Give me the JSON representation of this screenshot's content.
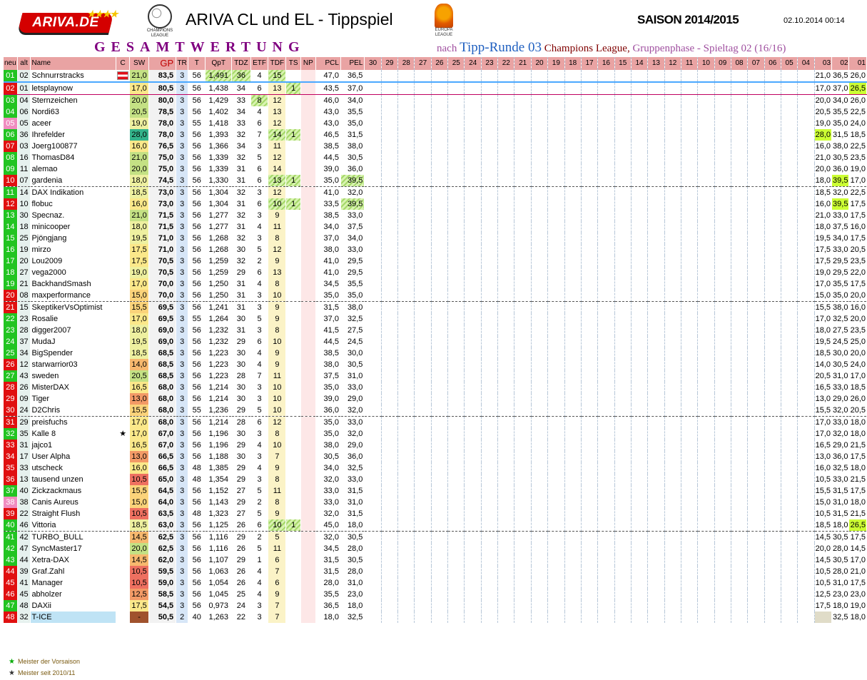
{
  "header": {
    "logo_text": "ARIVA.DE",
    "cl_logo_text": "CHAMPIONS LEAGUE",
    "el_logo_text": "EUROPA LEAGUE",
    "title": "ARIVA CL und EL - Tippspiel",
    "season": "SAISON 2014/2015",
    "timestamp": "02.10.2014 00:14",
    "gesamt": "GESAMTWERTUNG",
    "nach_1": "nach",
    "nach_2": "Tipp-Runde 03",
    "nach_3": "Champions League,",
    "nach_4": "Gruppenphase - Spieltag 02 (16/16)"
  },
  "columns": [
    "neu",
    "alt",
    "Name",
    "C",
    "SW",
    "GP",
    "TR",
    "T",
    "QpT",
    "TDZ",
    "ETF",
    "TDF",
    "TS",
    "NP",
    "PCL",
    "PEL"
  ],
  "round_columns": [
    "30",
    "29",
    "28",
    "27",
    "26",
    "25",
    "24",
    "23",
    "22",
    "21",
    "20",
    "19",
    "18",
    "17",
    "16",
    "15",
    "14",
    "13",
    "12",
    "11",
    "10",
    "09",
    "08",
    "07",
    "06",
    "05",
    "04",
    "03",
    "02",
    "01"
  ],
  "rank_colors": {
    "green": "#22c422",
    "red": "#e01010",
    "pink": "#f08cc0"
  },
  "rows": [
    [
      "01",
      "02",
      "Schnurrstracks",
      "",
      "21,0",
      "83,5",
      "3",
      "56",
      "1,491",
      "36",
      "4",
      "15",
      "",
      "",
      "47,0",
      "36,5",
      "21,0",
      "36,5",
      "26,0"
    ],
    [
      "02",
      "01",
      "letsplaynow",
      "",
      "17,0",
      "80,5",
      "3",
      "56",
      "1,438",
      "34",
      "6",
      "13",
      "1",
      "",
      "43,5",
      "37,0",
      "17,0",
      "37,0",
      "26,5"
    ],
    [
      "03",
      "04",
      "Sternzeichen",
      "",
      "20,0",
      "80,0",
      "3",
      "56",
      "1,429",
      "33",
      "8",
      "12",
      "",
      "",
      "46,0",
      "34,0",
      "20,0",
      "34,0",
      "26,0"
    ],
    [
      "04",
      "06",
      "Nordi63",
      "",
      "20,5",
      "78,5",
      "3",
      "56",
      "1,402",
      "34",
      "4",
      "13",
      "",
      "",
      "43,0",
      "35,5",
      "20,5",
      "35,5",
      "22,5"
    ],
    [
      "05",
      "05",
      "aceer",
      "",
      "19,0",
      "78,0",
      "3",
      "55",
      "1,418",
      "33",
      "6",
      "12",
      "",
      "",
      "43,0",
      "35,0",
      "19,0",
      "35,0",
      "24,0"
    ],
    [
      "06",
      "36",
      "Ihrefelder",
      "",
      "28,0",
      "78,0",
      "3",
      "56",
      "1,393",
      "32",
      "7",
      "14",
      "1",
      "",
      "46,5",
      "31,5",
      "28,0",
      "31,5",
      "18,5"
    ],
    [
      "07",
      "03",
      "Joerg100877",
      "",
      "16,0",
      "76,5",
      "3",
      "56",
      "1,366",
      "34",
      "3",
      "11",
      "",
      "",
      "38,5",
      "38,0",
      "16,0",
      "38,0",
      "22,5"
    ],
    [
      "08",
      "16",
      "ThomasD84",
      "",
      "21,0",
      "75,0",
      "3",
      "56",
      "1,339",
      "32",
      "5",
      "12",
      "",
      "",
      "44,5",
      "30,5",
      "21,0",
      "30,5",
      "23,5"
    ],
    [
      "09",
      "11",
      "alemao",
      "",
      "20,0",
      "75,0",
      "3",
      "56",
      "1,339",
      "31",
      "6",
      "14",
      "",
      "",
      "39,0",
      "36,0",
      "20,0",
      "36,0",
      "19,0"
    ],
    [
      "10",
      "07",
      "gardenia",
      "",
      "18,0",
      "74,5",
      "3",
      "56",
      "1,330",
      "31",
      "6",
      "13",
      "1",
      "",
      "35,0",
      "39,5",
      "18,0",
      "39,5",
      "17,0"
    ],
    [
      "11",
      "14",
      "DAX Indikation",
      "",
      "18,5",
      "73,0",
      "3",
      "56",
      "1,304",
      "32",
      "3",
      "12",
      "",
      "",
      "41,0",
      "32,0",
      "18,5",
      "32,0",
      "22,5"
    ],
    [
      "12",
      "10",
      "flobuc",
      "",
      "16,0",
      "73,0",
      "3",
      "56",
      "1,304",
      "31",
      "6",
      "10",
      "1",
      "",
      "33,5",
      "39,5",
      "16,0",
      "39,5",
      "17,5"
    ],
    [
      "13",
      "30",
      "Specnaz.",
      "",
      "21,0",
      "71,5",
      "3",
      "56",
      "1,277",
      "32",
      "3",
      "9",
      "",
      "",
      "38,5",
      "33,0",
      "21,0",
      "33,0",
      "17,5"
    ],
    [
      "14",
      "18",
      "minicooper",
      "",
      "18,0",
      "71,5",
      "3",
      "56",
      "1,277",
      "31",
      "4",
      "11",
      "",
      "",
      "34,0",
      "37,5",
      "18,0",
      "37,5",
      "16,0"
    ],
    [
      "15",
      "25",
      "Pjöngjang",
      "",
      "19,5",
      "71,0",
      "3",
      "56",
      "1,268",
      "32",
      "3",
      "8",
      "",
      "",
      "37,0",
      "34,0",
      "19,5",
      "34,0",
      "17,5"
    ],
    [
      "16",
      "19",
      "mirzo",
      "",
      "17,5",
      "71,0",
      "3",
      "56",
      "1,268",
      "30",
      "5",
      "12",
      "",
      "",
      "38,0",
      "33,0",
      "17,5",
      "33,0",
      "20,5"
    ],
    [
      "17",
      "20",
      "Lou2009",
      "",
      "17,5",
      "70,5",
      "3",
      "56",
      "1,259",
      "32",
      "2",
      "9",
      "",
      "",
      "41,0",
      "29,5",
      "17,5",
      "29,5",
      "23,5"
    ],
    [
      "18",
      "27",
      "vega2000",
      "",
      "19,0",
      "70,5",
      "3",
      "56",
      "1,259",
      "29",
      "6",
      "13",
      "",
      "",
      "41,0",
      "29,5",
      "19,0",
      "29,5",
      "22,0"
    ],
    [
      "19",
      "21",
      "BackhandSmash",
      "",
      "17,0",
      "70,0",
      "3",
      "56",
      "1,250",
      "31",
      "4",
      "8",
      "",
      "",
      "34,5",
      "35,5",
      "17,0",
      "35,5",
      "17,5"
    ],
    [
      "20",
      "08",
      "maxperformance",
      "",
      "15,0",
      "70,0",
      "3",
      "56",
      "1,250",
      "31",
      "3",
      "10",
      "",
      "",
      "35,0",
      "35,0",
      "15,0",
      "35,0",
      "20,0"
    ],
    [
      "21",
      "15",
      "SkeptikerVsOptimist",
      "",
      "15,5",
      "69,5",
      "3",
      "56",
      "1,241",
      "31",
      "3",
      "9",
      "",
      "",
      "31,5",
      "38,0",
      "15,5",
      "38,0",
      "16,0"
    ],
    [
      "22",
      "23",
      "Rosalie",
      "",
      "17,0",
      "69,5",
      "3",
      "55",
      "1,264",
      "30",
      "5",
      "9",
      "",
      "",
      "37,0",
      "32,5",
      "17,0",
      "32,5",
      "20,0"
    ],
    [
      "23",
      "28",
      "digger2007",
      "",
      "18,0",
      "69,0",
      "3",
      "56",
      "1,232",
      "31",
      "3",
      "8",
      "",
      "",
      "41,5",
      "27,5",
      "18,0",
      "27,5",
      "23,5"
    ],
    [
      "24",
      "37",
      "MudaJ",
      "",
      "19,5",
      "69,0",
      "3",
      "56",
      "1,232",
      "29",
      "6",
      "10",
      "",
      "",
      "44,5",
      "24,5",
      "19,5",
      "24,5",
      "25,0"
    ],
    [
      "25",
      "34",
      "BigSpender",
      "",
      "18,5",
      "68,5",
      "3",
      "56",
      "1,223",
      "30",
      "4",
      "9",
      "",
      "",
      "38,5",
      "30,0",
      "18,5",
      "30,0",
      "20,0"
    ],
    [
      "26",
      "12",
      "starwarrior03",
      "",
      "14,0",
      "68,5",
      "3",
      "56",
      "1,223",
      "30",
      "4",
      "9",
      "",
      "",
      "38,0",
      "30,5",
      "14,0",
      "30,5",
      "24,0"
    ],
    [
      "27",
      "43",
      "sweden",
      "",
      "20,5",
      "68,5",
      "3",
      "56",
      "1,223",
      "28",
      "7",
      "11",
      "",
      "",
      "37,5",
      "31,0",
      "20,5",
      "31,0",
      "17,0"
    ],
    [
      "28",
      "26",
      "MisterDAX",
      "",
      "16,5",
      "68,0",
      "3",
      "56",
      "1,214",
      "30",
      "3",
      "10",
      "",
      "",
      "35,0",
      "33,0",
      "16,5",
      "33,0",
      "18,5"
    ],
    [
      "29",
      "09",
      "Tiger",
      "",
      "13,0",
      "68,0",
      "3",
      "56",
      "1,214",
      "30",
      "3",
      "10",
      "",
      "",
      "39,0",
      "29,0",
      "13,0",
      "29,0",
      "26,0"
    ],
    [
      "30",
      "24",
      "D2Chris",
      "",
      "15,5",
      "68,0",
      "3",
      "55",
      "1,236",
      "29",
      "5",
      "10",
      "",
      "",
      "36,0",
      "32,0",
      "15,5",
      "32,0",
      "20,5"
    ],
    [
      "31",
      "29",
      "preisfuchs",
      "",
      "17,0",
      "68,0",
      "3",
      "56",
      "1,214",
      "28",
      "6",
      "12",
      "",
      "",
      "35,0",
      "33,0",
      "17,0",
      "33,0",
      "18,0"
    ],
    [
      "32",
      "35",
      "Kalle 8",
      "★",
      "17,0",
      "67,0",
      "3",
      "56",
      "1,196",
      "30",
      "3",
      "8",
      "",
      "",
      "35,0",
      "32,0",
      "17,0",
      "32,0",
      "18,0"
    ],
    [
      "33",
      "31",
      "jajco1",
      "",
      "16,5",
      "67,0",
      "3",
      "56",
      "1,196",
      "29",
      "4",
      "10",
      "",
      "",
      "38,0",
      "29,0",
      "16,5",
      "29,0",
      "21,5"
    ],
    [
      "34",
      "17",
      "User Alpha",
      "",
      "13,0",
      "66,5",
      "3",
      "56",
      "1,188",
      "30",
      "3",
      "7",
      "",
      "",
      "30,5",
      "36,0",
      "13,0",
      "36,0",
      "17,5"
    ],
    [
      "35",
      "33",
      "utscheck",
      "",
      "16,0",
      "66,5",
      "3",
      "48",
      "1,385",
      "29",
      "4",
      "9",
      "",
      "",
      "34,0",
      "32,5",
      "16,0",
      "32,5",
      "18,0"
    ],
    [
      "36",
      "13",
      "tausend unzen",
      "",
      "10,5",
      "65,0",
      "3",
      "48",
      "1,354",
      "29",
      "3",
      "8",
      "",
      "",
      "32,0",
      "33,0",
      "10,5",
      "33,0",
      "21,5"
    ],
    [
      "37",
      "40",
      "Zickzackmaus",
      "",
      "15,5",
      "64,5",
      "3",
      "56",
      "1,152",
      "27",
      "5",
      "11",
      "",
      "",
      "33,0",
      "31,5",
      "15,5",
      "31,5",
      "17,5"
    ],
    [
      "38",
      "38",
      "Canis Aureus",
      "",
      "15,0",
      "64,0",
      "3",
      "56",
      "1,143",
      "29",
      "2",
      "8",
      "",
      "",
      "33,0",
      "31,0",
      "15,0",
      "31,0",
      "18,0"
    ],
    [
      "39",
      "22",
      "Straight Flush",
      "",
      "10,5",
      "63,5",
      "3",
      "48",
      "1,323",
      "27",
      "5",
      "9",
      "",
      "",
      "32,0",
      "31,5",
      "10,5",
      "31,5",
      "21,5"
    ],
    [
      "40",
      "46",
      "Vittoria",
      "",
      "18,5",
      "63,0",
      "3",
      "56",
      "1,125",
      "26",
      "6",
      "10",
      "1",
      "",
      "45,0",
      "18,0",
      "18,5",
      "18,0",
      "26,5"
    ],
    [
      "41",
      "42",
      "TURBO_BULL",
      "",
      "14,5",
      "62,5",
      "3",
      "56",
      "1,116",
      "29",
      "2",
      "5",
      "",
      "",
      "32,0",
      "30,5",
      "14,5",
      "30,5",
      "17,5"
    ],
    [
      "42",
      "47",
      "SyncMaster17",
      "",
      "20,0",
      "62,5",
      "3",
      "56",
      "1,116",
      "26",
      "5",
      "11",
      "",
      "",
      "34,5",
      "28,0",
      "20,0",
      "28,0",
      "14,5"
    ],
    [
      "43",
      "44",
      "Xetra-DAX",
      "",
      "14,5",
      "62,0",
      "3",
      "56",
      "1,107",
      "29",
      "1",
      "6",
      "",
      "",
      "31,5",
      "30,5",
      "14,5",
      "30,5",
      "17,0"
    ],
    [
      "44",
      "39",
      "Graf.Zahl",
      "",
      "10,5",
      "59,5",
      "3",
      "56",
      "1,063",
      "26",
      "4",
      "7",
      "",
      "",
      "31,5",
      "28,0",
      "10,5",
      "28,0",
      "21,0"
    ],
    [
      "45",
      "41",
      "Manager",
      "",
      "10,5",
      "59,0",
      "3",
      "56",
      "1,054",
      "26",
      "4",
      "6",
      "",
      "",
      "28,0",
      "31,0",
      "10,5",
      "31,0",
      "17,5"
    ],
    [
      "46",
      "45",
      "abholzer",
      "",
      "12,5",
      "58,5",
      "3",
      "56",
      "1,045",
      "25",
      "4",
      "9",
      "",
      "",
      "35,5",
      "23,0",
      "12,5",
      "23,0",
      "23,0"
    ],
    [
      "47",
      "48",
      "DAXii",
      "",
      "17,5",
      "54,5",
      "3",
      "56",
      "0,973",
      "24",
      "3",
      "7",
      "",
      "",
      "36,5",
      "18,0",
      "17,5",
      "18,0",
      "19,0"
    ],
    [
      "48",
      "32",
      "T-ICE",
      "",
      "-",
      "50,5",
      "2",
      "40",
      "1,263",
      "22",
      "3",
      "7",
      "",
      "",
      "18,0",
      "32,5",
      "",
      "32,5",
      "18,0"
    ]
  ],
  "legend": {
    "item1": "Meister der Vorsaison",
    "item2": "Meister seit 2010/11"
  }
}
